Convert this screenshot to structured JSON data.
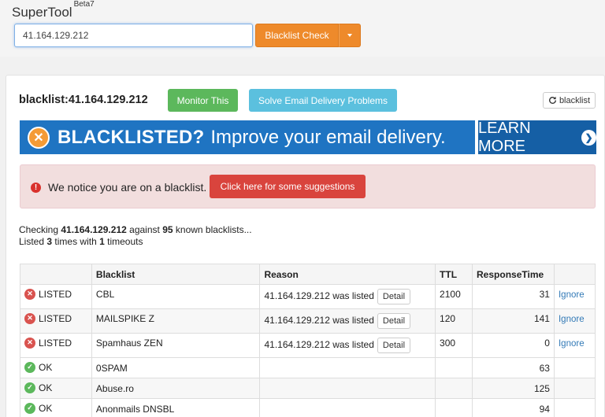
{
  "header": {
    "brand": "SuperTool",
    "beta": "Beta7",
    "search_value": "41.164.129.212",
    "check_label": "Blacklist Check"
  },
  "result": {
    "title": "blacklist:41.164.129.212",
    "monitor_label": "Monitor This",
    "solve_label": "Solve Email Delivery Problems",
    "refresh_label": "blacklist"
  },
  "banner": {
    "headline": "BLACKLISTED?",
    "text": "Improve your email delivery.",
    "cta": "LEARN MORE"
  },
  "alert": {
    "text": "We notice you are on a blacklist.",
    "button": "Click here for some suggestions"
  },
  "summary": {
    "prefix": "Checking",
    "ip": "41.164.129.212",
    "against": "against",
    "count": "95",
    "suffix": "known blacklists...",
    "listed_prefix": "Listed",
    "listed_count": "3",
    "listed_mid": "times with",
    "timeouts": "1",
    "timeouts_suffix": "timeouts"
  },
  "table": {
    "headers": [
      "",
      "Blacklist",
      "Reason",
      "TTL",
      "ResponseTime",
      ""
    ],
    "rows": [
      {
        "status": "LISTED",
        "blacklist": "CBL",
        "reason": "41.164.129.212 was listed",
        "detail": "Detail",
        "ttl": "2100",
        "response": "31",
        "action": "Ignore"
      },
      {
        "status": "LISTED",
        "blacklist": "MAILSPIKE Z",
        "reason": "41.164.129.212 was listed",
        "detail": "Detail",
        "ttl": "120",
        "response": "141",
        "action": "Ignore"
      },
      {
        "status": "LISTED",
        "blacklist": "Spamhaus ZEN",
        "reason": "41.164.129.212 was listed",
        "detail": "Detail",
        "ttl": "300",
        "response": "0",
        "action": "Ignore"
      },
      {
        "status": "OK",
        "blacklist": "0SPAM",
        "response": "63"
      },
      {
        "status": "OK",
        "blacklist": "Abuse.ro",
        "response": "125"
      },
      {
        "status": "OK",
        "blacklist": "Anonmails DNSBL",
        "response": "94"
      }
    ]
  },
  "colors": {
    "orange": "#ee8a2b",
    "green": "#5cb85c",
    "cyan": "#5bc0de",
    "red": "#d9443d",
    "banner_blue": "#1f74c2"
  }
}
